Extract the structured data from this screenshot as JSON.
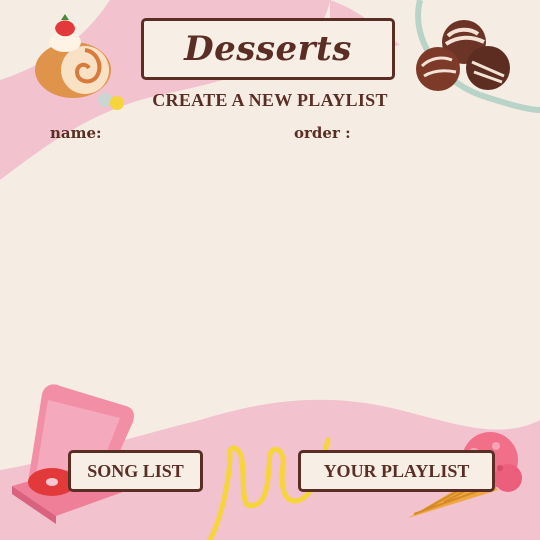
{
  "header": {
    "title": "Desserts",
    "subtitle": "CREATE A NEW PLAYLIST"
  },
  "form": {
    "name_label": "name:",
    "order_label": "order :"
  },
  "buttons": {
    "song_list": "SONG LIST",
    "your_playlist": "YOUR PLAYLIST"
  },
  "colors": {
    "background": "#f5ede3",
    "accent_pink": "#f2c2cf",
    "text_brown": "#5a2e25",
    "yellow": "#f5d53a"
  },
  "icons": [
    "cake-roll-icon",
    "chocolate-truffles-icon",
    "record-player-icon",
    "ice-cream-cone-icon"
  ]
}
